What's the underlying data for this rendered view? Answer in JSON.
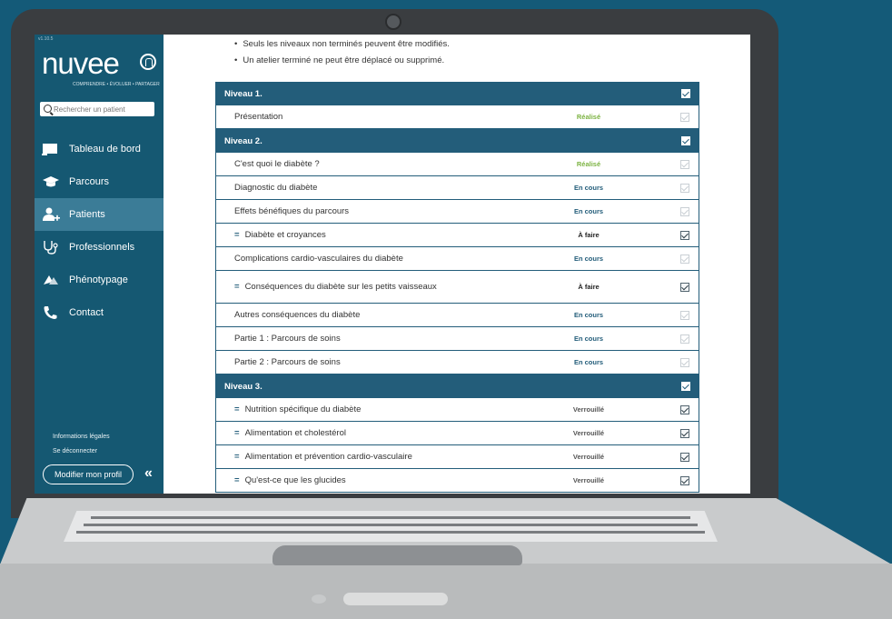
{
  "sidebar": {
    "version": "v1.10.5",
    "logo_text": "nuvee",
    "tagline": "COMPRENDRE • ÉVOLUER • PARTAGER",
    "search_placeholder": "Rechercher un patient",
    "nav": [
      {
        "label": "Tableau de bord",
        "icon": "dashboard-icon"
      },
      {
        "label": "Parcours",
        "icon": "graduation-cap-icon"
      },
      {
        "label": "Patients",
        "icon": "add-user-icon",
        "active": true
      },
      {
        "label": "Professionnels",
        "icon": "stethoscope-icon"
      },
      {
        "label": "Phénotypage",
        "icon": "phenotype-icon"
      },
      {
        "label": "Contact",
        "icon": "phone-icon"
      }
    ],
    "legal": "Informations légales",
    "logout": "Se déconnecter",
    "profile_button": "Modifier mon profil",
    "collapse_glyph": "«"
  },
  "notes": [
    "Seuls les niveaux non terminés peuvent être modifiés.",
    "Un atelier terminé ne peut être déplacé ou supprimé."
  ],
  "levels": [
    {
      "title": "Niveau 1.",
      "rows": [
        {
          "label": "Présentation",
          "status": "Réalisé",
          "kind": "done"
        }
      ]
    },
    {
      "title": "Niveau 2.",
      "rows": [
        {
          "label": "C'est quoi le diabète ?",
          "status": "Réalisé",
          "kind": "done"
        },
        {
          "label": "Diagnostic du diabète",
          "status": "En cours",
          "kind": "prog"
        },
        {
          "label": "Effets bénéfiques du parcours",
          "status": "En cours",
          "kind": "prog"
        },
        {
          "label": "Diabète et croyances",
          "status": "À faire",
          "kind": "todo",
          "drag": true
        },
        {
          "label": "Complications cardio-vasculaires du diabète",
          "status": "En cours",
          "kind": "prog"
        },
        {
          "label": "Conséquences du diabète sur les petits vaisseaux",
          "status": "À faire",
          "kind": "todo",
          "drag": true,
          "tall": true
        },
        {
          "label": "Autres conséquences du diabète",
          "status": "En cours",
          "kind": "prog"
        },
        {
          "label": "Partie 1 : Parcours de soins",
          "status": "En cours",
          "kind": "prog"
        },
        {
          "label": "Partie 2 : Parcours de soins",
          "status": "En cours",
          "kind": "prog"
        }
      ]
    },
    {
      "title": "Niveau 3.",
      "rows": [
        {
          "label": "Nutrition spécifique du diabète",
          "status": "Verrouillé",
          "kind": "lock",
          "drag": true
        },
        {
          "label": "Alimentation et cholestérol",
          "status": "Verrouillé",
          "kind": "lock",
          "drag": true
        },
        {
          "label": "Alimentation et prévention cardio-vasculaire",
          "status": "Verrouillé",
          "kind": "lock",
          "drag": true
        },
        {
          "label": "Qu'est-ce que les glucides",
          "status": "Verrouillé",
          "kind": "lock",
          "drag": true
        }
      ]
    }
  ],
  "drag_glyph": "="
}
